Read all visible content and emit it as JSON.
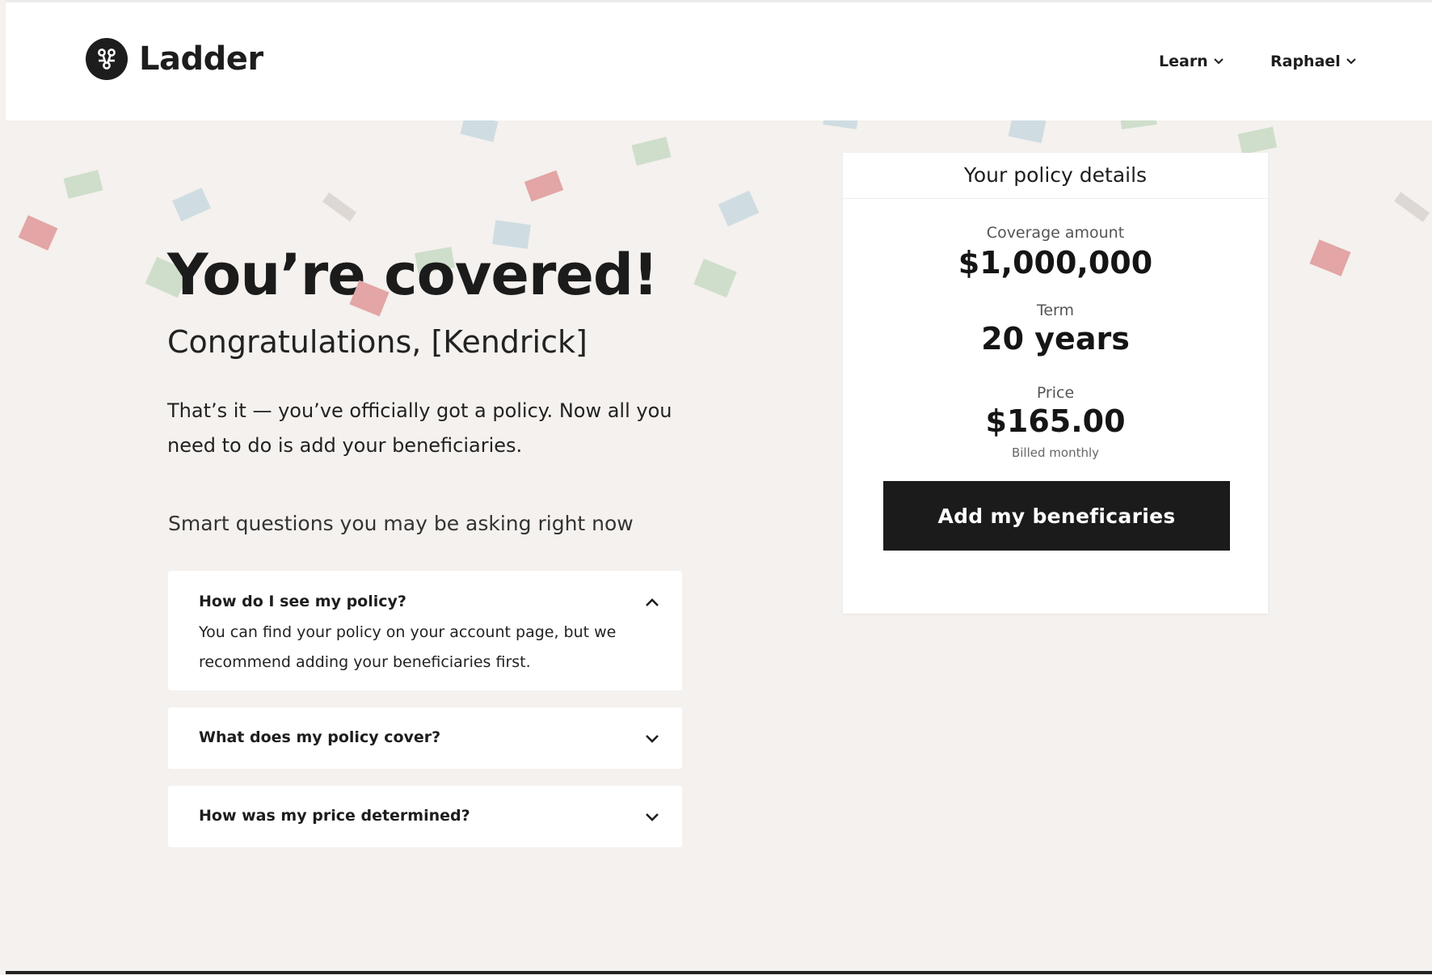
{
  "header": {
    "brand": "Ladder",
    "nav": [
      {
        "label": "Learn"
      },
      {
        "label": "Raphael"
      }
    ]
  },
  "hero": {
    "title": "You’re covered!",
    "subtitle": "Congratulations, [Kendrick]",
    "body": "That’s it — you’ve officially got a policy. Now all you need to do is add your beneficiaries."
  },
  "faq": {
    "heading": "Smart questions you may be asking right now",
    "items": [
      {
        "question": "How do I see my policy?",
        "answer": "You can find your policy on your account page, but we recommend adding your beneficiaries first.",
        "expanded": true
      },
      {
        "question": "What does my policy cover?",
        "expanded": false
      },
      {
        "question": "How was my price determined?",
        "expanded": false
      }
    ]
  },
  "policy": {
    "title": "Your policy details",
    "coverage_label": "Coverage amount",
    "coverage_value": "$1,000,000",
    "term_label": "Term",
    "term_value": "20 years",
    "price_label": "Price",
    "price_value": "$165.00",
    "billing_note": "Billed monthly",
    "cta_label": "Add my beneficaries"
  },
  "colors": {
    "background": "#f4f1ee",
    "text": "#1d1d1d",
    "button": "#1b1b1b",
    "confetti": [
      "#e3a5a5",
      "#cfdecb",
      "#cfdde2",
      "#ddd8d4"
    ]
  }
}
